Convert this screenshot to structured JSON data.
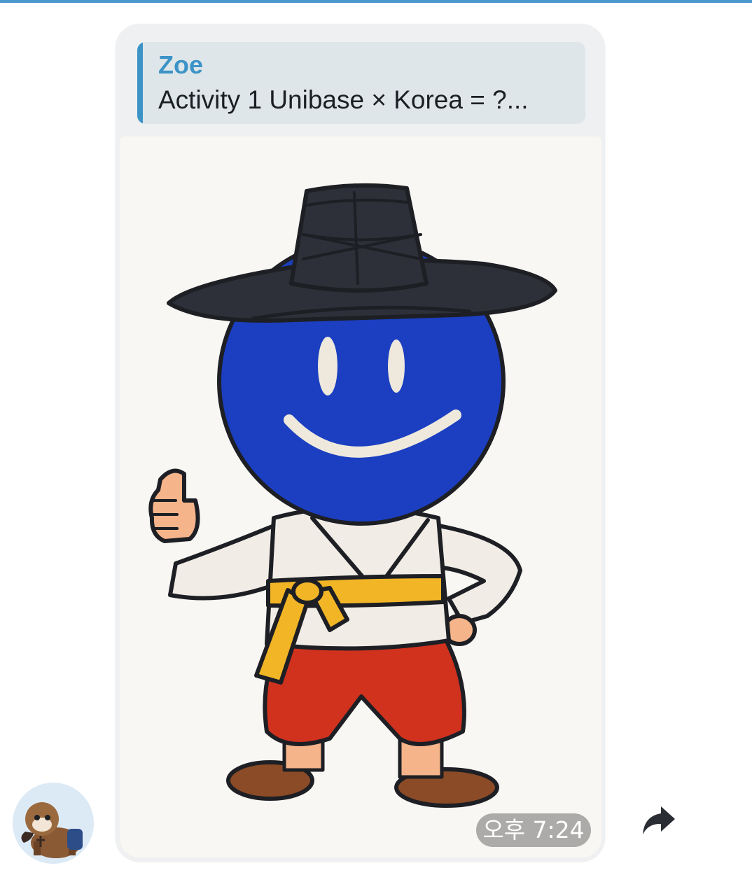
{
  "message": {
    "reply": {
      "author": "Zoe",
      "text": "Activity 1  Unibase × Korea = ?..."
    },
    "time": "오후 7:24"
  },
  "colors": {
    "accent": "#3c93c6",
    "top_bar": "#4a97d0",
    "bubble_bg": "#eef0f2",
    "reply_bg": "#dfe6ea",
    "mascot_face": "#1b3fc0",
    "hat": "#2d3038",
    "belt": "#f2b526",
    "pants": "#d0321e",
    "shoes": "#8a4b26"
  },
  "icons": {
    "forward": "forward-arrow-icon",
    "avatar": "user-avatar"
  }
}
